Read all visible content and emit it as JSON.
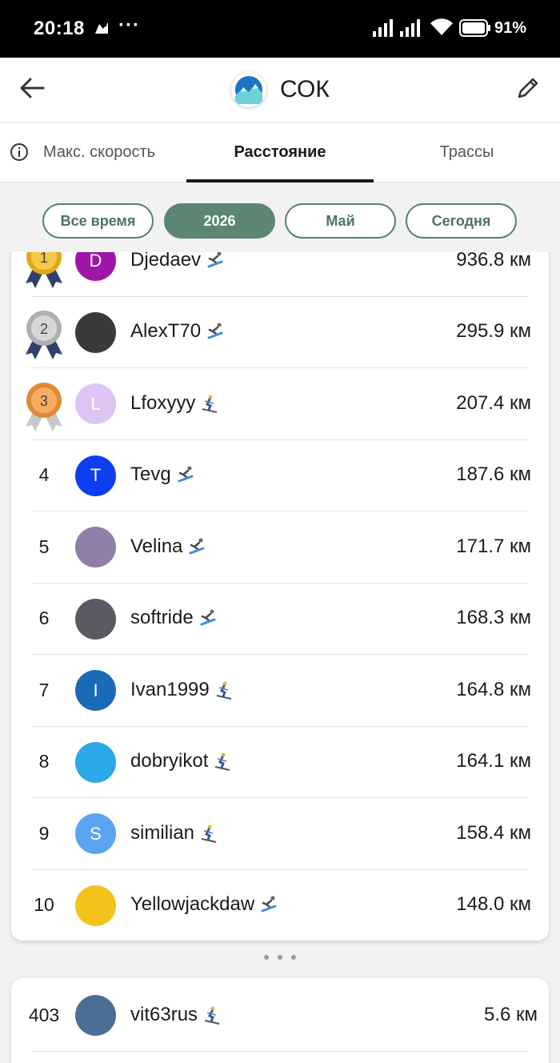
{
  "status_bar": {
    "time": "20:18",
    "more": "···",
    "battery": "91%"
  },
  "header": {
    "title": "СОК"
  },
  "tabs": [
    {
      "label": "Макс. скорость"
    },
    {
      "label": "Расстояние"
    },
    {
      "label": "Трассы"
    }
  ],
  "filters": [
    {
      "label": "Все время",
      "active": false
    },
    {
      "label": "2026",
      "active": true
    },
    {
      "label": "Май",
      "active": false
    },
    {
      "label": "Сегодня",
      "active": false
    }
  ],
  "leaderboard": [
    {
      "rank": "1",
      "medal": "gold",
      "name": "Djedaev",
      "distance": "936.8 км",
      "avatar": "D",
      "avatar_color": "#a015a8",
      "sport": "snowboard"
    },
    {
      "rank": "2",
      "medal": "silver",
      "name": "AlexT70",
      "distance": "295.9 км",
      "avatar": "",
      "avatar_color": "#3a3a3a",
      "sport": "snowboard"
    },
    {
      "rank": "3",
      "medal": "bronze",
      "name": "Lfoxyyy",
      "distance": "207.4 км",
      "avatar": "L",
      "avatar_color": "#dcc5f4",
      "sport": "ski"
    },
    {
      "rank": "4",
      "medal": "",
      "name": "Tevg",
      "distance": "187.6 км",
      "avatar": "T",
      "avatar_color": "#0f3df0",
      "sport": "snowboard"
    },
    {
      "rank": "5",
      "medal": "",
      "name": "Velina",
      "distance": "171.7 км",
      "avatar": "",
      "avatar_color": "#8f7fa8",
      "sport": "snowboard"
    },
    {
      "rank": "6",
      "medal": "",
      "name": "softride",
      "distance": "168.3 км",
      "avatar": "",
      "avatar_color": "#5a5a62",
      "sport": "snowboard"
    },
    {
      "rank": "7",
      "medal": "",
      "name": "Ivan1999",
      "distance": "164.8 км",
      "avatar": "I",
      "avatar_color": "#1a6ab8",
      "sport": "ski"
    },
    {
      "rank": "8",
      "medal": "",
      "name": "dobryikot",
      "distance": "164.1 км",
      "avatar": "",
      "avatar_color": "#2aa8e8",
      "sport": "ski"
    },
    {
      "rank": "9",
      "medal": "",
      "name": "similian",
      "distance": "158.4 км",
      "avatar": "S",
      "avatar_color": "#5ba4f2",
      "sport": "ski"
    },
    {
      "rank": "10",
      "medal": "",
      "name": "Yellowjackdaw",
      "distance": "148.0 км",
      "avatar": "",
      "avatar_color": "#f4c21a",
      "sport": "snowboard"
    }
  ],
  "self_entry": {
    "rank": "403",
    "name": "vit63rus",
    "distance": "5.6 км",
    "avatar": "",
    "avatar_color": "#4a6f94",
    "sport": "ski"
  }
}
